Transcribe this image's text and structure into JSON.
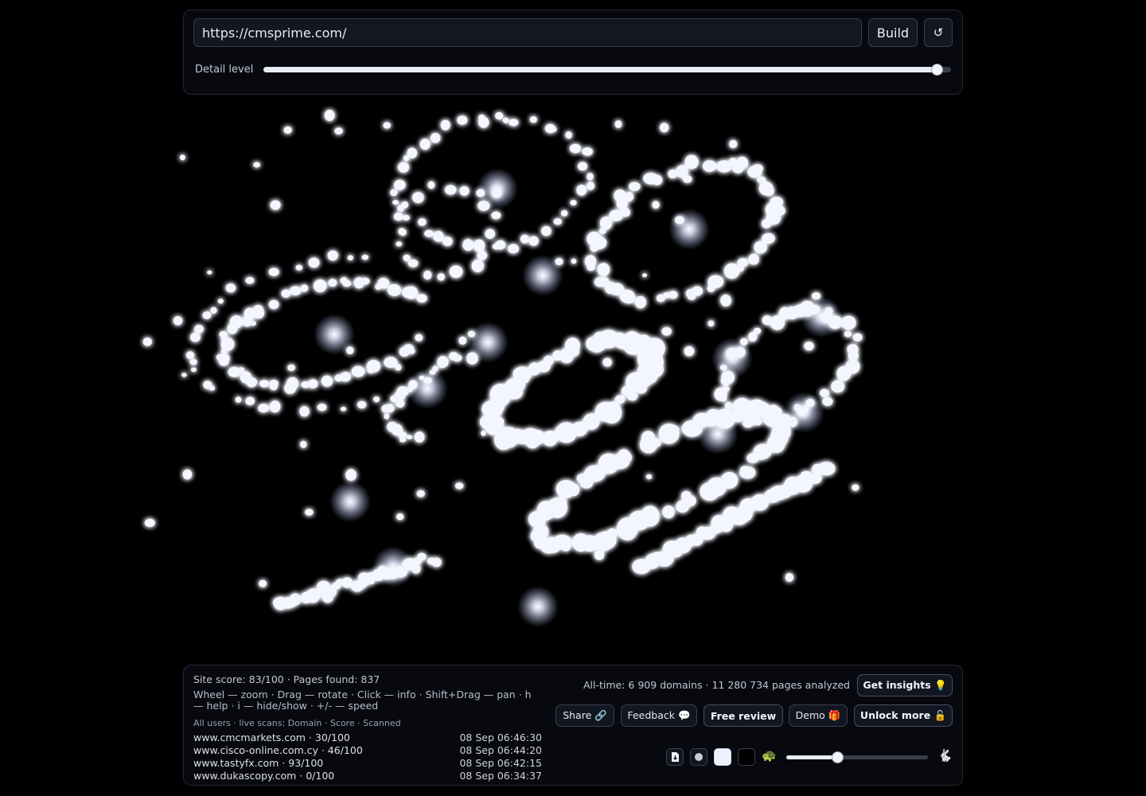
{
  "toolbar": {
    "url_value": "https://cmsprime.com/",
    "build_label": "Build",
    "reset_icon": "↺",
    "detail_label": "Detail level",
    "detail_value_percent": 98
  },
  "visualization": {
    "description": "3D point-cloud sitemap galaxy"
  },
  "footer": {
    "site_score_text": "Site score: 83/100 · Pages found: 837",
    "help_text": "Wheel — zoom · Drag — rotate · Click — info · Shift+Drag — pan · h — help · i — hide/show · +/- — speed",
    "scans_header": "All users · live scans: Domain · Score · Scanned",
    "scans": [
      {
        "domain": "www.cmcmarkets.com · 30/100",
        "time": "08 Sep 06:46:30"
      },
      {
        "domain": "www.cisco-online.com.cy · 46/100",
        "time": "08 Sep 06:44:20"
      },
      {
        "domain": "www.tastyfx.com · 93/100",
        "time": "08 Sep 06:42:15"
      },
      {
        "domain": "www.dukascopy.com · 0/100",
        "time": "08 Sep 06:34:37"
      }
    ],
    "alltime_text": "All-time: 6 909 domains · 11 280 734 pages analyzed",
    "get_insights_label": "Get insights 💡",
    "share_label": "Share 🔗",
    "feedback_label": "Feedback 💬",
    "free_review_label": "Free review",
    "demo_label": "Demo 🎁",
    "unlock_label": "Unlock more 🔓",
    "turtle_icon": "🐢",
    "rabbit_icon": "🐇",
    "speed_value_percent": 36
  },
  "icons": [
    "download-icon",
    "dot-icon",
    "light-theme-icon",
    "dark-theme-icon",
    "turtle-icon",
    "rabbit-icon",
    "reset-icon"
  ]
}
